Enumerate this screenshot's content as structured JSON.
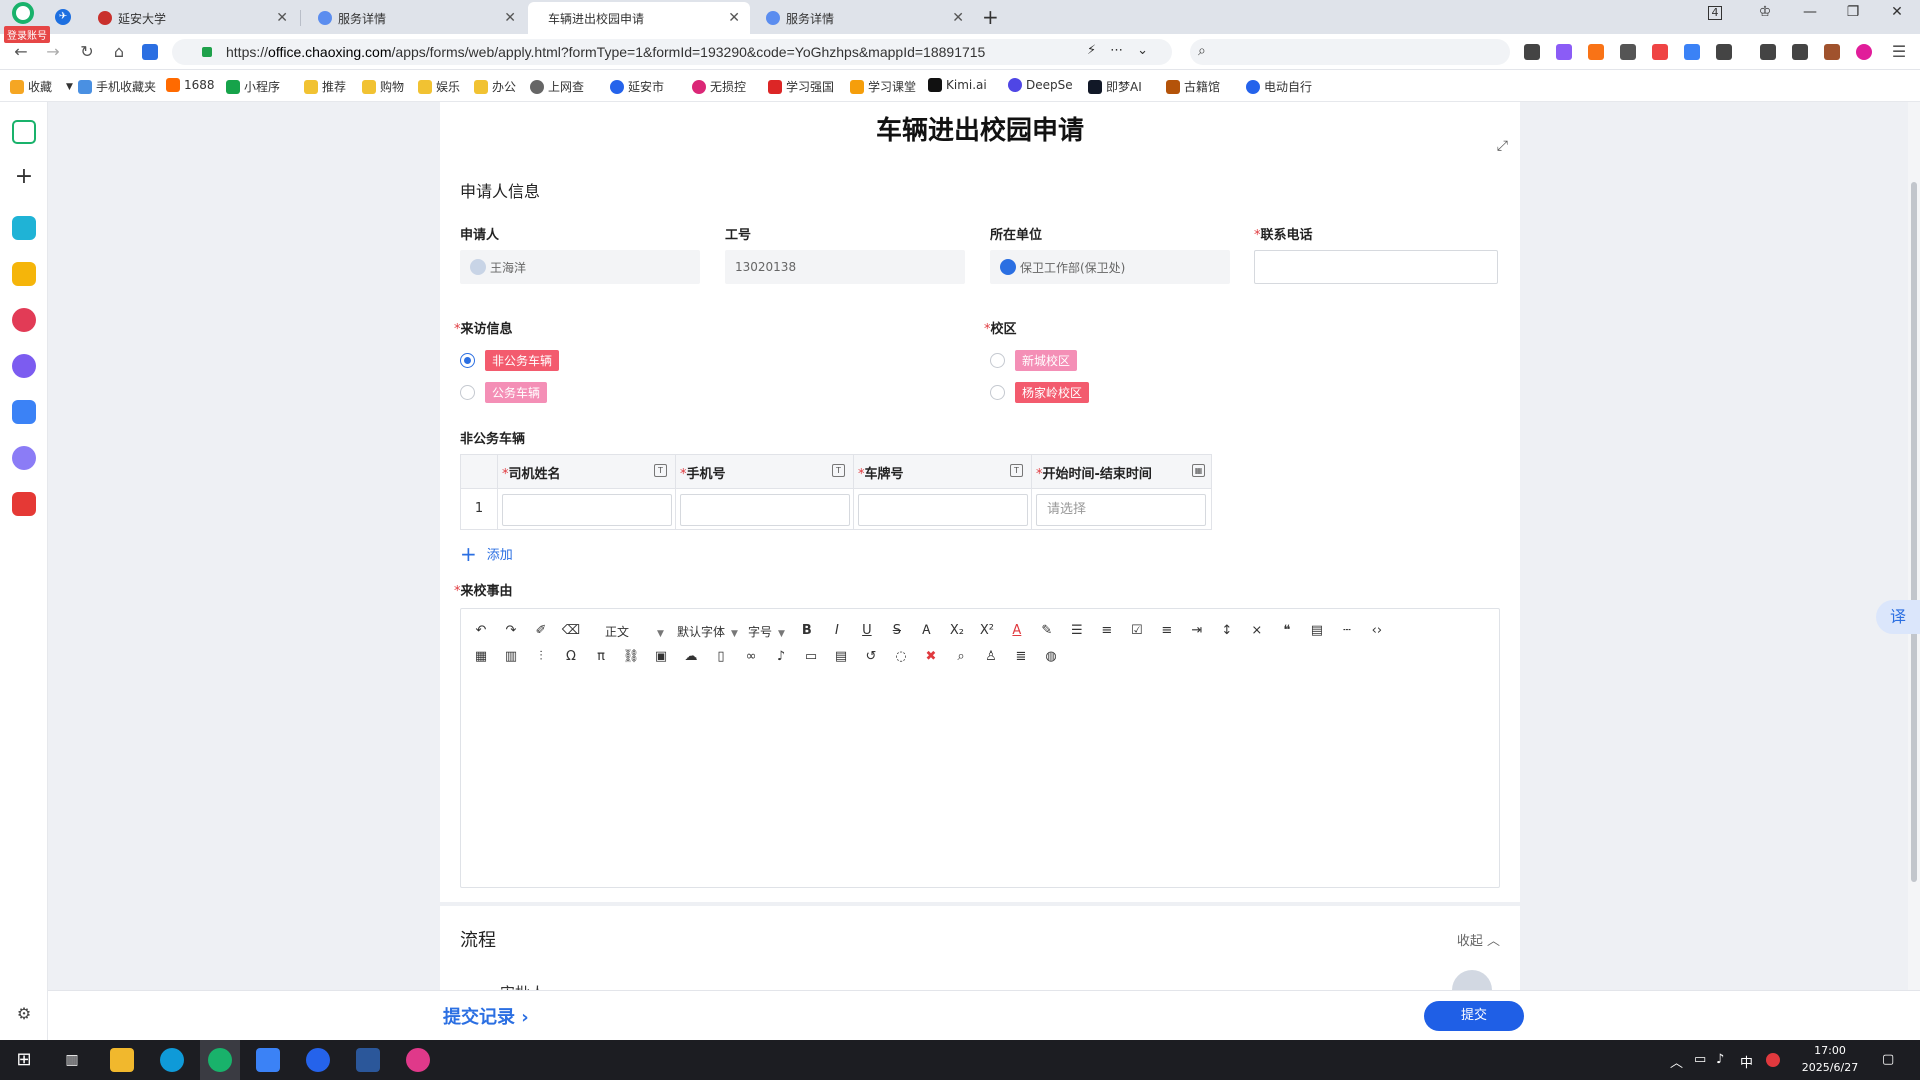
{
  "browser": {
    "login_badge": "登录账号",
    "tabs": [
      {
        "title": "延安大学",
        "active": false
      },
      {
        "title": "服务详情",
        "active": false
      },
      {
        "title": "车辆进出校园申请",
        "active": true
      },
      {
        "title": "服务详情",
        "active": false
      }
    ],
    "tab_count_badge": "4",
    "url_prefix": "https://",
    "url_host": "office.chaoxing.com",
    "url_path": "/apps/forms/web/apply.html?formType=1&formId=193290&code=YoGhzhps&mappId=18891715"
  },
  "bookmarks": [
    {
      "label": "收藏",
      "color": "#f5a623"
    },
    {
      "label": "手机收藏夹",
      "color": "#4a90e2"
    },
    {
      "label": "1688",
      "color": "#ff6a00"
    },
    {
      "label": "小程序",
      "color": "#16a34a"
    },
    {
      "label": "推荐",
      "color": "#f1c232"
    },
    {
      "label": "购物",
      "color": "#f1c232"
    },
    {
      "label": "娱乐",
      "color": "#f1c232"
    },
    {
      "label": "办公",
      "color": "#f1c232"
    },
    {
      "label": "上网查",
      "color": "#666666"
    },
    {
      "label": "延安市",
      "color": "#2563eb"
    },
    {
      "label": "无损控",
      "color": "#db2777"
    },
    {
      "label": "学习强国",
      "color": "#dc2626"
    },
    {
      "label": "学习课堂",
      "color": "#f59e0b"
    },
    {
      "label": "Kimi.ai",
      "color": "#111111"
    },
    {
      "label": "DeepSe",
      "color": "#4f46e5"
    },
    {
      "label": "即梦AI",
      "color": "#111827"
    },
    {
      "label": "古籍馆",
      "color": "#b45309"
    },
    {
      "label": "电动自行",
      "color": "#2563eb"
    }
  ],
  "form": {
    "title": "车辆进出校园申请",
    "applicant_section": "申请人信息",
    "applicant": {
      "label": "申请人",
      "value": "王海洋"
    },
    "employee_id": {
      "label": "工号",
      "value": "13020138"
    },
    "unit": {
      "label": "所在单位",
      "value": "保卫工作部(保卫处)"
    },
    "phone": {
      "label": "联系电话",
      "value": ""
    },
    "required_mark": "*",
    "visit_info": {
      "label": "来访信息",
      "options": [
        {
          "label": "非公务车辆",
          "checked": true,
          "color": "#f35b6e"
        },
        {
          "label": "公务车辆",
          "checked": false,
          "color": "#f48fb6"
        }
      ]
    },
    "campus": {
      "label": "校区",
      "options": [
        {
          "label": "新城校区",
          "checked": false,
          "color": "#f48fb6"
        },
        {
          "label": "杨家岭校区",
          "checked": false,
          "color": "#f35b6e"
        }
      ]
    },
    "vehicle_table": {
      "title": "非公务车辆",
      "columns": [
        "司机姓名",
        "手机号",
        "车牌号",
        "开始时间-结束时间"
      ],
      "row_number": "1",
      "time_placeholder": "请选择"
    },
    "add_label": "添加",
    "reason": {
      "label": "来校事由"
    },
    "editor": {
      "paragraph_select": "正文",
      "font_select": "默认字体",
      "size_select": "字号",
      "color_letter": "A"
    }
  },
  "process": {
    "title": "流程",
    "collapse_label": "收起",
    "approver_label": "审批人"
  },
  "bottom": {
    "history_link": "提交记录",
    "submit_label": "提交"
  },
  "float_translate": "译",
  "taskbar": {
    "ime": "中",
    "time": "17:00",
    "date": "2025/6/27"
  }
}
